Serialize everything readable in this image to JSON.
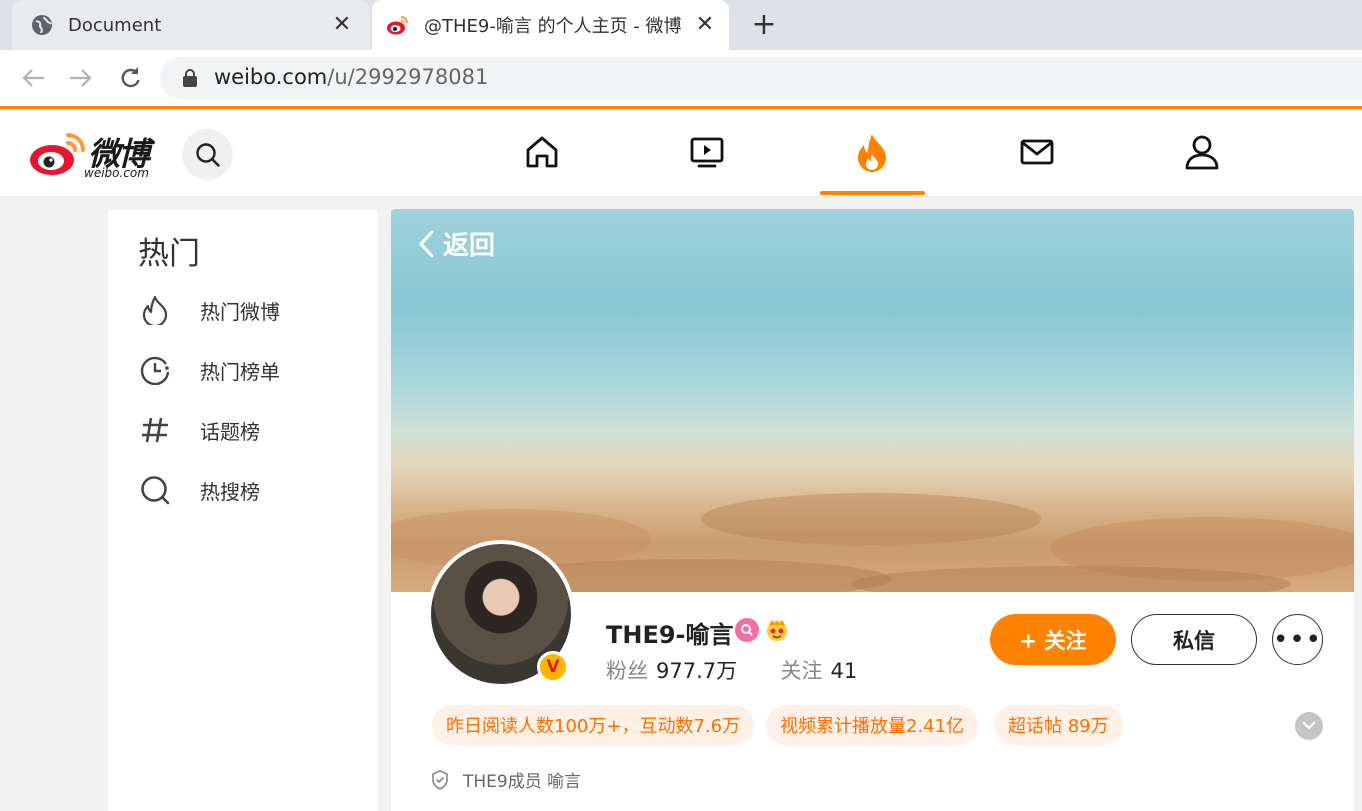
{
  "browser": {
    "tabs": [
      {
        "title": "Document",
        "favicon": "globe-icon",
        "active": false
      },
      {
        "title": "@THE9-喻言 的个人主页 - 微博",
        "favicon": "weibo-icon",
        "active": true
      }
    ],
    "url": {
      "host": "weibo.com",
      "path": "/u/2992978081"
    }
  },
  "header": {
    "logo_cn": "微博",
    "logo_en": "weibo.com",
    "nav": [
      "home-icon",
      "video-icon",
      "hot-icon",
      "mail-icon",
      "profile-icon"
    ],
    "active_nav": "hot-icon",
    "accent_color": "#ff8200"
  },
  "sidebar": {
    "title": "热门",
    "items": [
      {
        "label": "热门微博",
        "icon": "flame-icon"
      },
      {
        "label": "热门榜单",
        "icon": "clock-icon"
      },
      {
        "label": "话题榜",
        "icon": "hashtag-icon"
      },
      {
        "label": "热搜榜",
        "icon": "hot-search-icon"
      }
    ]
  },
  "profile": {
    "back_label": "返回",
    "name": "THE9-喻言",
    "verified_badge": "V",
    "fans_label": "粉丝",
    "fans_value": "977.7万",
    "follow_label": "关注",
    "follow_value": "41",
    "follow_button": "+ 关注",
    "dm_button": "私信",
    "more_button": "•••",
    "pills": [
      "昨日阅读人数100万+，互动数7.6万",
      "视频累计播放量2.41亿",
      "超话帖 89万"
    ],
    "member_text": "THE9成员 喻言"
  }
}
